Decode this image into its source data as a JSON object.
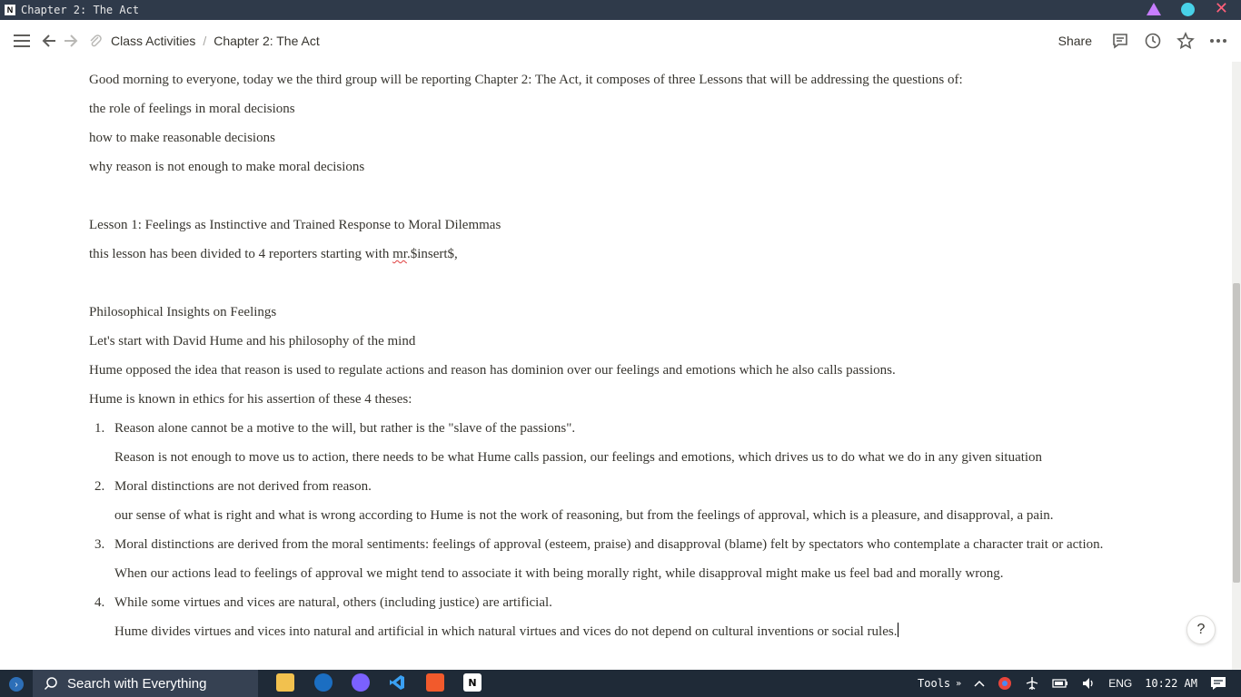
{
  "window": {
    "title": "Chapter 2: The Act",
    "logo": "N"
  },
  "topbar": {
    "breadcrumb": [
      "Class Activities",
      "Chapter 2: The Act"
    ],
    "share_label": "Share"
  },
  "content": {
    "intro": "Good morning to everyone, today we the third group will be reporting Chapter 2: The Act, it composes of three Lessons that will be addressing the questions of:",
    "questions": [
      "the role of feelings in moral decisions",
      "how to make reasonable decisions",
      "why reason is not enough to make moral decisions"
    ],
    "lesson_title": "Lesson 1: Feelings as Instinctive and Trained Response to Moral Dilemmas",
    "lesson_note_prefix": "this lesson has been divided to 4 reporters starting with ",
    "lesson_note_misspelled": "mr",
    "lesson_note_suffix": ".$insert$,",
    "section_title": "Philosophical Insights on Feelings",
    "hume_start": "Let's start with David Hume and his philosophy of the mind",
    "hume_opposed": "Hume opposed the idea that reason is used to regulate actions and reason has dominion over our feelings and emotions which he also calls passions.",
    "hume_known": "Hume is known in ethics for his assertion of these 4 theses:",
    "theses": [
      {
        "num": "1.",
        "text": "Reason alone cannot be a motive to the will, but rather is the \"slave of the passions\".",
        "note": "Reason is not enough to move us to action, there needs to be what Hume calls passion, our feelings and emotions, which drives us to do what we do in any given situation"
      },
      {
        "num": "2.",
        "text": "Moral distinctions are not derived from reason.",
        "note": "our sense of what is right and what is wrong according to Hume is not the work of reasoning, but from the feelings of approval, which is a pleasure, and disapproval, a pain."
      },
      {
        "num": "3.",
        "text": "Moral distinctions are derived from the moral sentiments: feelings of approval (esteem, praise) and disapproval (blame) felt by spectators who contemplate a character trait or action.",
        "note": "When our actions lead to feelings of approval we might tend to associate it with being morally right, while disapproval might make us feel bad and morally wrong."
      },
      {
        "num": "4.",
        "text": "While some virtues and vices are natural, others (including justice) are artificial.",
        "note": "Hume divides virtues and vices into natural and artificial in which natural virtues and vices do not depend on cultural inventions or social rules."
      }
    ],
    "help_label": "?"
  },
  "taskbar": {
    "search_label": "Search with Everything",
    "tools_label": "Tools",
    "tools_chevron": "»",
    "language": "ENG",
    "time": "10:22 AM"
  },
  "colors": {
    "titlebar_bg": "#2f3a4a",
    "taskbar_bg": "#1f2a37",
    "text": "#37352f",
    "min_button": "#c77dff",
    "max_button": "#48d1e8",
    "close_button": "#ff5f7a"
  },
  "icons": {
    "menu": "hamburger-icon",
    "back": "arrow-left-icon",
    "forward": "arrow-right-icon",
    "page": "paperclip-icon",
    "comments": "comment-icon",
    "updates": "clock-icon",
    "favorite": "star-icon",
    "more": "ellipsis-icon"
  }
}
